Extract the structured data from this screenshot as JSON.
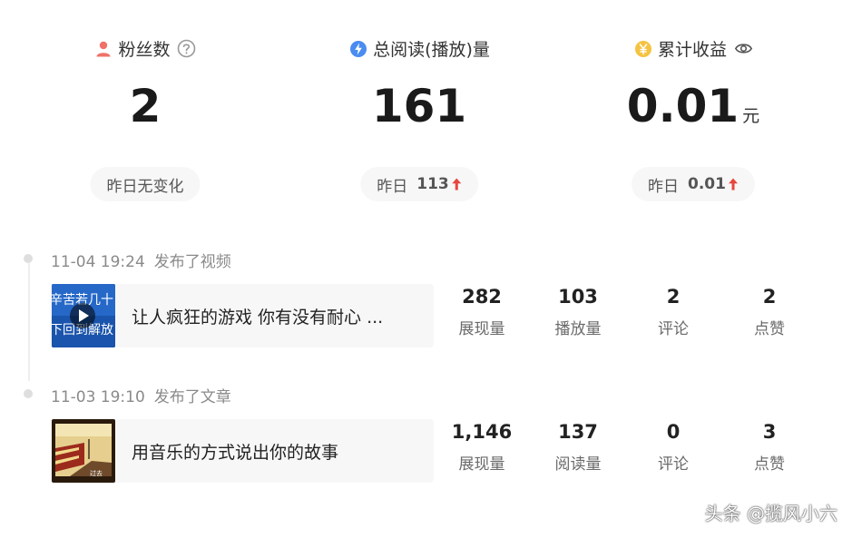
{
  "stats": {
    "fans": {
      "label": "粉丝数",
      "value": "2",
      "sub_text": "昨日无变化",
      "icon": "user-icon",
      "info_icon": "question-circle-icon"
    },
    "reads": {
      "label": "总阅读(播放)量",
      "value": "161",
      "sub_prefix": "昨日",
      "sub_value": "113",
      "icon": "lightning-icon",
      "trend_icon": "arrow-up-icon"
    },
    "earnings": {
      "label": "累计收益",
      "value": "0.01",
      "unit": "元",
      "sub_prefix": "昨日",
      "sub_value": "0.01",
      "icon": "yen-coin-icon",
      "visibility_icon": "eye-icon",
      "trend_icon": "arrow-up-icon"
    }
  },
  "timeline": [
    {
      "datetime": "11-04 19:24",
      "action": "发布了视频",
      "title": "让人疯狂的游戏 你有没有耐心 ...",
      "thumb_text_top": "辛苦若几十",
      "thumb_text_bottom": "下回到解放",
      "metrics": [
        {
          "value": "282",
          "label": "展现量"
        },
        {
          "value": "103",
          "label": "播放量"
        },
        {
          "value": "2",
          "label": "评论"
        },
        {
          "value": "2",
          "label": "点赞"
        }
      ]
    },
    {
      "datetime": "11-03 19:10",
      "action": "发布了文章",
      "title": "用音乐的方式说出你的故事",
      "metrics": [
        {
          "value": "1,146",
          "label": "展现量"
        },
        {
          "value": "137",
          "label": "阅读量"
        },
        {
          "value": "0",
          "label": "评论"
        },
        {
          "value": "3",
          "label": "点赞"
        }
      ]
    }
  ],
  "watermark": "头条 @揽风小六",
  "colors": {
    "user_icon": "#f07167",
    "lightning_icon": "#4a8cf0",
    "coin_icon": "#f5c342",
    "trend_up": "#e8453c",
    "pill_bg": "#f7f7f7",
    "card_bg": "#f7f7f8"
  }
}
